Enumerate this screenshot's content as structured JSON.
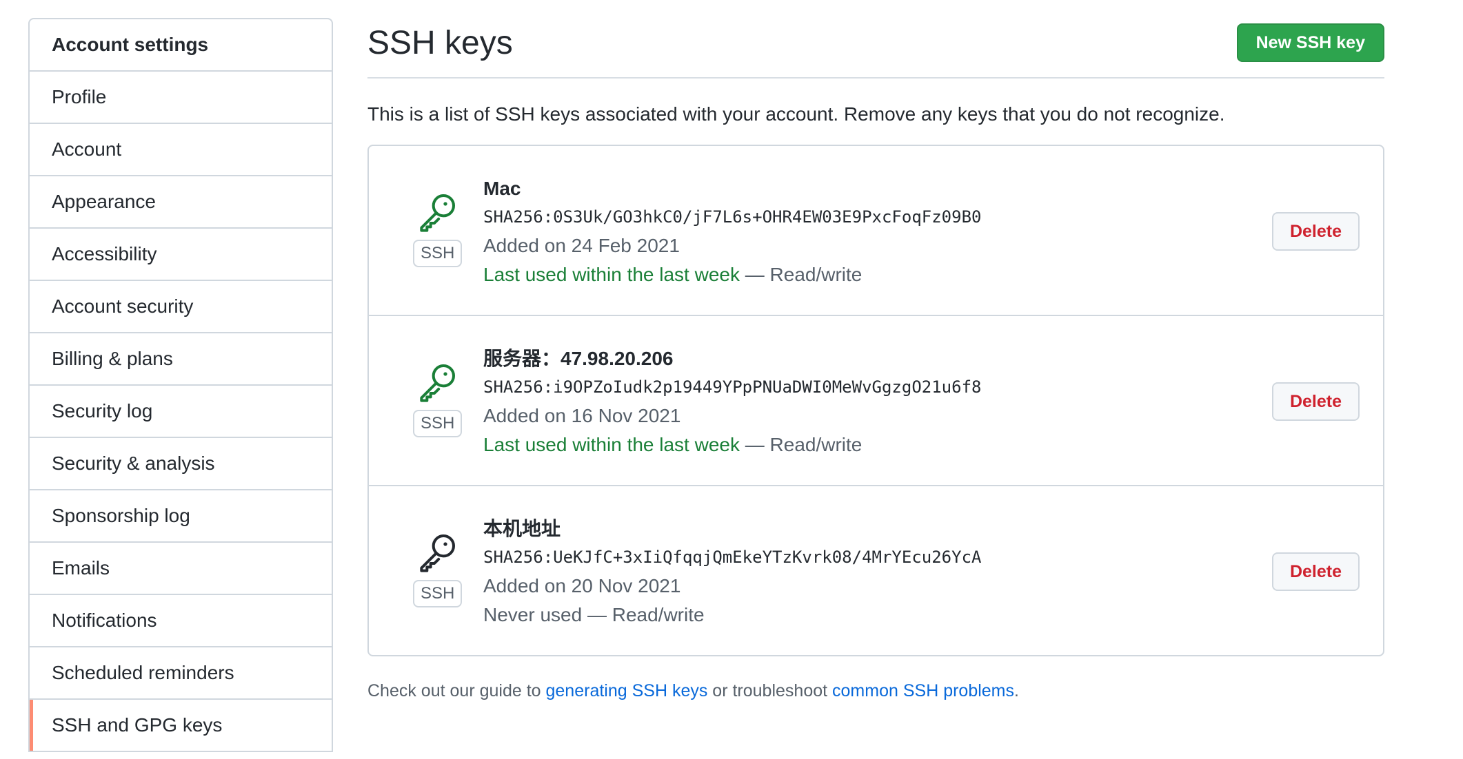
{
  "sidebar": {
    "heading": "Account settings",
    "items": [
      {
        "label": "Profile"
      },
      {
        "label": "Account"
      },
      {
        "label": "Appearance"
      },
      {
        "label": "Accessibility"
      },
      {
        "label": "Account security"
      },
      {
        "label": "Billing & plans"
      },
      {
        "label": "Security log"
      },
      {
        "label": "Security & analysis"
      },
      {
        "label": "Sponsorship log"
      },
      {
        "label": "Emails"
      },
      {
        "label": "Notifications"
      },
      {
        "label": "Scheduled reminders"
      },
      {
        "label": "SSH and GPG keys",
        "active": true
      }
    ]
  },
  "header": {
    "title": "SSH keys",
    "new_key_label": "New SSH key"
  },
  "description": "This is a list of SSH keys associated with your account. Remove any keys that you do not recognize.",
  "keys": [
    {
      "title": "Mac",
      "fingerprint": "SHA256:0S3Uk/GO3hkC0/jF7L6s+OHR4EW03E9PxcFoqFz09B0",
      "added": "Added on 24 Feb 2021",
      "usage": "Last used within the last week",
      "access": " — Read/write",
      "badge": "SSH",
      "icon": "key-icon",
      "icon_color": "#1a7f37",
      "delete_label": "Delete"
    },
    {
      "title": "服务器：47.98.20.206",
      "fingerprint": "SHA256:i9OPZoIudk2p19449YPpPNUaDWI0MeWvGgzgO21u6f8",
      "added": "Added on 16 Nov 2021",
      "usage": "Last used within the last week",
      "access": " — Read/write",
      "badge": "SSH",
      "icon": "key-icon",
      "icon_color": "#1a7f37",
      "delete_label": "Delete"
    },
    {
      "title": "本机地址",
      "fingerprint": "SHA256:UeKJfC+3xIiQfqqjQmEkeYTzKvrk08/4MrYEcu26YcA",
      "added": "Added on 20 Nov 2021",
      "usage": "Never used",
      "access": " — Read/write",
      "badge": "SSH",
      "icon": "key-icon",
      "icon_color": "#24292f",
      "delete_label": "Delete"
    }
  ],
  "footer": {
    "prefix": "Check out our guide to ",
    "link1": "generating SSH keys",
    "middle": " or troubleshoot ",
    "link2": "common SSH problems",
    "suffix": "."
  },
  "colors": {
    "primary_button": "#2da44e",
    "danger_text": "#cf222e",
    "success_text": "#1a7f37",
    "link": "#0969da",
    "active_indicator": "#fd8c73"
  }
}
